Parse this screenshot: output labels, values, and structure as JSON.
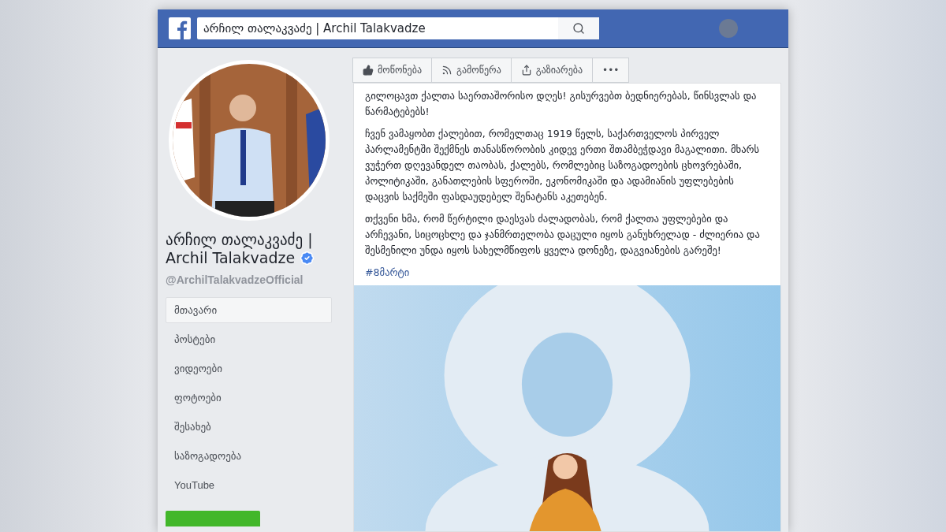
{
  "header": {
    "search": {
      "value": "არჩილ თალაკვაძე | Archil Talakvadze"
    }
  },
  "actions": [
    {
      "kind": "like",
      "label": "მოწონება"
    },
    {
      "kind": "follow",
      "label": "გამოწერა"
    },
    {
      "kind": "share",
      "label": "გაზიარება"
    },
    {
      "kind": "more",
      "label": "•••"
    }
  ],
  "profile": {
    "name": "არჩილ თალაკვაძე | Archil Talakvadze",
    "verified": true,
    "handle": "@ArchilTalakvadzeOfficial"
  },
  "nav": [
    {
      "label": "მთავარი",
      "selected": true
    },
    {
      "label": "პოსტები",
      "selected": false
    },
    {
      "label": "ვიდეოები",
      "selected": false
    },
    {
      "label": "ფოტოები",
      "selected": false
    },
    {
      "label": "შესახებ",
      "selected": false
    },
    {
      "label": "საზოგადოება",
      "selected": false
    },
    {
      "label": "YouTube",
      "selected": false
    }
  ],
  "post": {
    "paragraphs": [
      "გილოცავთ ქალთა საერთაშორისო დღეს! გისურვებთ ბედნიერებას, წინსვლას და წარმატებებს!",
      "ჩვენ ვამაყობთ ქალებით, რომელთაც 1919 წელს, საქართველოს პირველ პარლამენტში შექმნეს თანასწორობის კიდევ ერთი შთამბეჭდავი მაგალითი. მხარს ვუჭერთ დღევანდელ თაობას, ქალებს, რომლებიც საზოგადოების ცხოვრებაში, პოლიტიკაში, განათლების სფეროში, ეკონომიკაში და ადამიანის უფლებების დაცვის საქმეში ფასდაუდებელ შენატანს აკეთებენ.",
      "თქვენი ხმა, რომ წერტილი დაესვას ძალადობას, რომ ქალთა უფლებები და არჩევანი, სიცოცხლე და ჯანმრთელობა დაცული იყოს განუხრელად - ძლიერია და შესმენილი უნდა იყოს სახელმწიფოს ყველა დონეზე, დაგვიანების გარეშე!"
    ],
    "hashtag": "#8მარტი"
  }
}
